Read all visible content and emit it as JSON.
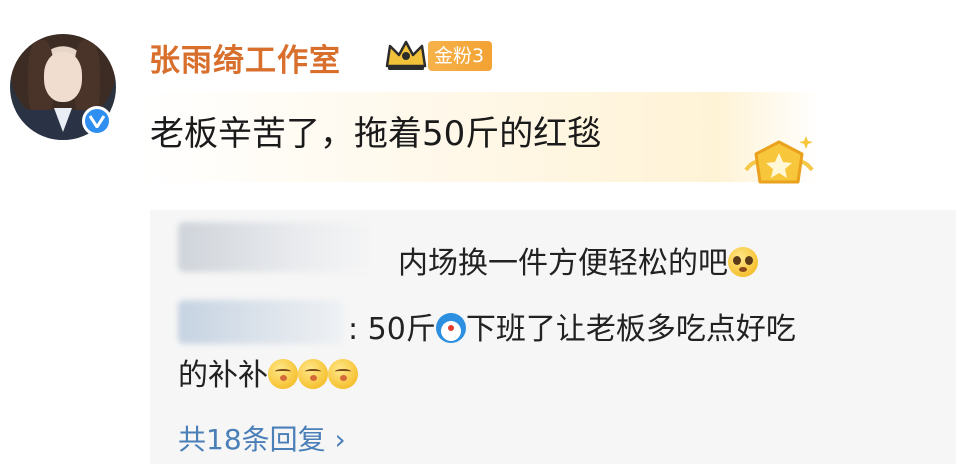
{
  "post": {
    "username": "张雨绮工作室",
    "fan_badge": "金粉3",
    "text": "老板辛苦了，拖着50斤的红毯"
  },
  "comments": [
    {
      "user": "",
      "text": "内场换一件方便轻松的吧",
      "emoji": "pleading-face-emoji"
    },
    {
      "user": "",
      "text_part1": ": 50斤",
      "text_part2": "下班了让老板多吃点好吃",
      "text_line2": "的补补",
      "emojis": [
        "kissing-face-emoji",
        "kissing-face-emoji",
        "kissing-face-emoji"
      ]
    }
  ],
  "replies_link": "共18条回复 ›",
  "colors": {
    "username": "#d86f2c",
    "fan_badge": "#f3a233",
    "verified": "#2f8ff0",
    "link": "#4a7fb8",
    "comment_bg": "#f6f6f6"
  },
  "icons": [
    "crown-icon",
    "verified-badge-icon",
    "star-badge-icon",
    "doraemon-emoji",
    "kissing-face-emoji",
    "pleading-face-emoji",
    "chevron-right-icon"
  ]
}
